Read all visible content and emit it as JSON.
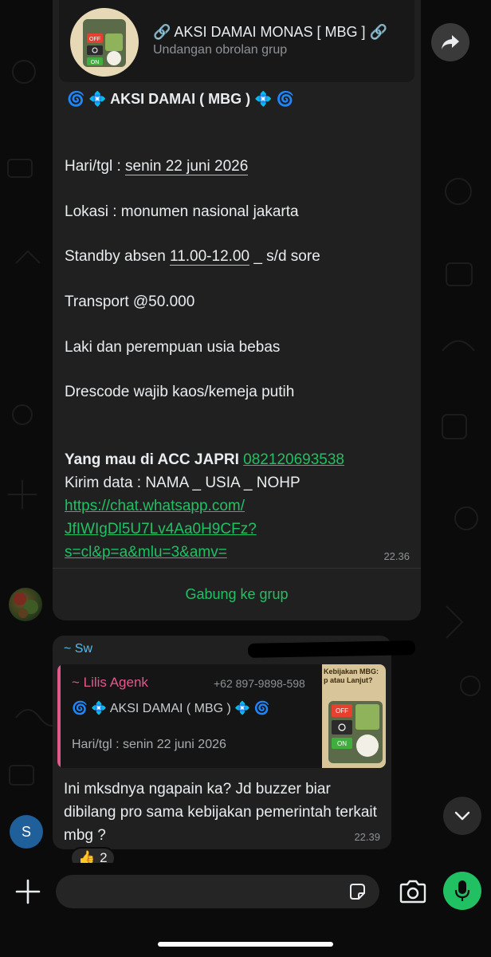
{
  "invite": {
    "title": "🔗 AKSI DAMAI MONAS [ MBG ] 🔗",
    "subtitle": "Undangan obrolan grup",
    "thumb_text_off": "OFF",
    "thumb_text_on": "ON"
  },
  "message1": {
    "title": "🌀 💠  AKSI DAMAI ( MBG )  💠 🌀",
    "date_label": "Hari/tgl : ",
    "date_value": "senin 22 juni 2026",
    "location": "Lokasi : monumen nasional jakarta",
    "standby_label": "Standby absen ",
    "standby_time": "11.00-12.00",
    "standby_suffix": " _ s/d sore",
    "transport": "Transport @50.000",
    "gender": "Laki dan perempuan usia bebas",
    "dresscode": "Drescode wajib kaos/kemeja putih",
    "acc_label": "Yang mau di ACC JAPRI ",
    "phone": "082120693538",
    "send_data": "Kirim data : NAMA _ USIA _ NOHP",
    "link_line1": "https://chat.whatsapp.com/",
    "link_line2": "JfIWIgDl5U7Lv4Aa0H9CFz?",
    "link_line3": "s=cl&p=a&mlu=3&amv=",
    "time": "22.36",
    "join_button": "Gabung ke grup"
  },
  "message2": {
    "sender": "~ Sw",
    "quote_name": "~ Lilis Agenk",
    "quote_phone": "+62 897-9898-598",
    "quote_title": "🌀 💠  AKSI DAMAI ( MBG )  💠 🌀",
    "quote_date": "Hari/tgl : senin 22 juni 2026",
    "quote_thumb_caption": "Kebijakan MBG: p atau Lanjut?",
    "text": "Ini mksdnya ngapain ka? Jd buzzer biar dibilang pro sama kebijakan pemerintah terkait mbg ?",
    "time": "22.39",
    "reaction_emoji": "👍",
    "reaction_count": "2"
  },
  "avatars": {
    "second_initial": "S"
  },
  "composer": {
    "placeholder": ""
  },
  "colors": {
    "accent_green": "#21c063",
    "sender_blue": "#53bdeb",
    "quote_pink": "#e2598c"
  }
}
